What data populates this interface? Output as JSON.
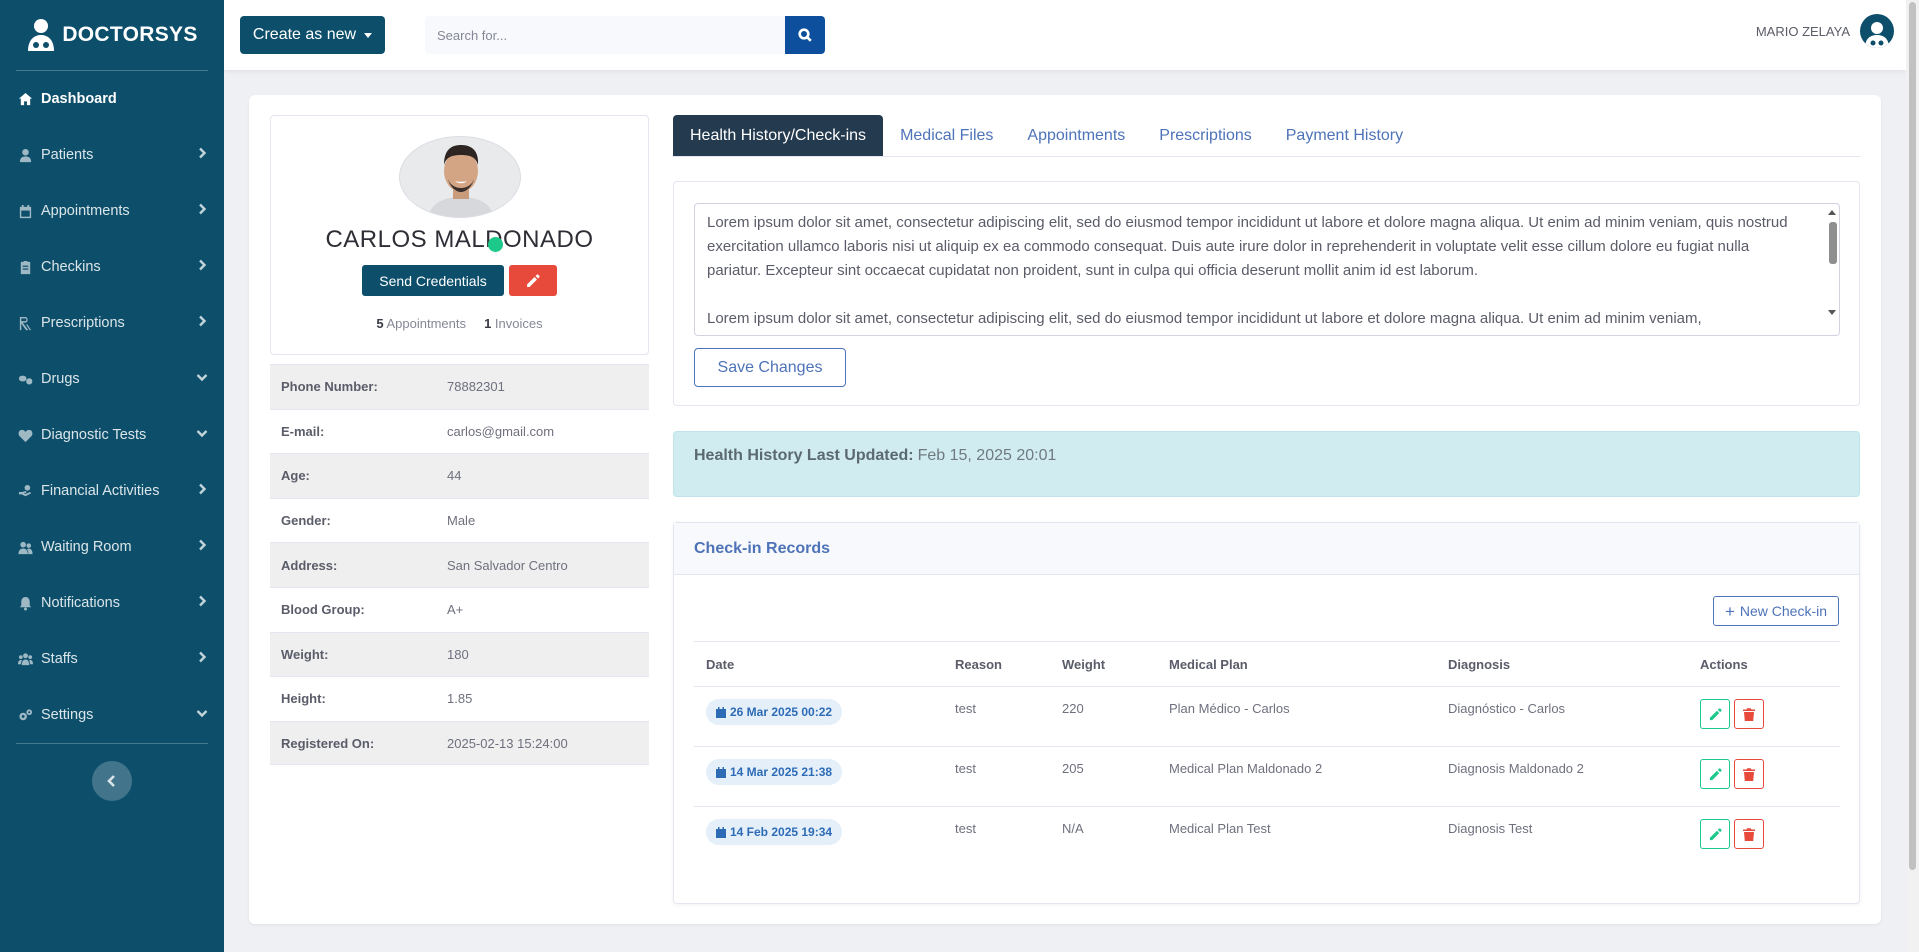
{
  "brand": {
    "name": "DOCTORSYS"
  },
  "sidebar": {
    "items": [
      {
        "label": "Dashboard",
        "icon": "home-icon",
        "active": true
      },
      {
        "label": "Patients",
        "icon": "user-icon",
        "chevron": "right"
      },
      {
        "label": "Appointments",
        "icon": "calendar-icon",
        "chevron": "right"
      },
      {
        "label": "Checkins",
        "icon": "clipboard-icon",
        "chevron": "right"
      },
      {
        "label": "Prescriptions",
        "icon": "prescription-icon",
        "chevron": "right"
      },
      {
        "label": "Drugs",
        "icon": "pills-icon",
        "chevron": "down"
      },
      {
        "label": "Diagnostic Tests",
        "icon": "heartbeat-icon",
        "chevron": "down"
      },
      {
        "label": "Financial Activities",
        "icon": "hand-money-icon",
        "chevron": "right"
      },
      {
        "label": "Waiting Room",
        "icon": "users-icon",
        "chevron": "right"
      },
      {
        "label": "Notifications",
        "icon": "bell-icon",
        "chevron": "right"
      },
      {
        "label": "Staffs",
        "icon": "team-icon",
        "chevron": "right"
      },
      {
        "label": "Settings",
        "icon": "cogs-icon",
        "chevron": "down"
      }
    ]
  },
  "topbar": {
    "create_label": "Create as new",
    "search_placeholder": "Search for...",
    "user_name": "MARIO ZELAYA"
  },
  "patient": {
    "name": "CARLOS MALDONADO",
    "send_credentials_label": "Send Credentials",
    "appointments_count": "5",
    "appointments_label": "Appointments",
    "invoices_count": "1",
    "invoices_label": "Invoices",
    "details": [
      {
        "label": "Phone Number:",
        "value": "78882301"
      },
      {
        "label": "E-mail:",
        "value": "carlos@gmail.com"
      },
      {
        "label": "Age:",
        "value": "44"
      },
      {
        "label": "Gender:",
        "value": "Male"
      },
      {
        "label": "Address:",
        "value": "San Salvador Centro"
      },
      {
        "label": "Blood Group:",
        "value": "A+"
      },
      {
        "label": "Weight:",
        "value": "180"
      },
      {
        "label": "Height:",
        "value": "1.85"
      },
      {
        "label": "Registered On:",
        "value": "2025-02-13 15:24:00"
      }
    ]
  },
  "tabs": [
    {
      "label": "Health History/Check-ins",
      "active": true
    },
    {
      "label": "Medical Files"
    },
    {
      "label": "Appointments"
    },
    {
      "label": "Prescriptions"
    },
    {
      "label": "Payment History"
    }
  ],
  "notes": {
    "paragraph_1": "Lorem ipsum dolor sit amet, consectetur adipiscing elit, sed do eiusmod tempor incididunt ut labore et dolore magna aliqua. Ut enim ad minim veniam, quis nostrud exercitation ullamco laboris nisi ut aliquip ex ea commodo consequat. Duis aute irure dolor in reprehenderit in voluptate velit esse cillum dolore eu fugiat nulla pariatur. Excepteur sint occaecat cupidatat non proident, sunt in culpa qui officia deserunt mollit anim id est laborum.",
    "paragraph_2": "Lorem ipsum dolor sit amet, consectetur adipiscing elit, sed do eiusmod tempor incididunt ut labore et dolore magna aliqua. Ut enim ad minim veniam,",
    "save_label": "Save Changes"
  },
  "history": {
    "label": "Health History Last Updated:",
    "value": "Feb 15, 2025 20:01"
  },
  "checkins": {
    "title": "Check-in Records",
    "new_label": "New Check-in",
    "columns": [
      "Date",
      "Reason",
      "Weight",
      "Medical Plan",
      "Diagnosis",
      "Actions"
    ],
    "rows": [
      {
        "date": "26 Mar 2025 00:22",
        "reason": "test",
        "weight": "220",
        "plan": "Plan Médico - Carlos",
        "diagnosis": "Diagnóstico - Carlos"
      },
      {
        "date": "14 Mar 2025 21:38",
        "reason": "test",
        "weight": "205",
        "plan": "Medical Plan Maldonado 2",
        "diagnosis": "Diagnosis Maldonado 2"
      },
      {
        "date": "14 Feb 2025 19:34",
        "reason": "test",
        "weight": "N/A",
        "plan": "Medical Plan Test",
        "diagnosis": "Diagnosis Test"
      }
    ]
  },
  "colors": {
    "sidebar": "#0d4f6b",
    "active_tab": "#243a4e",
    "accent_blue": "#4e73b8",
    "danger": "#e74a3b",
    "success": "#1cc88a",
    "info_alert": "#d1ecf1"
  }
}
